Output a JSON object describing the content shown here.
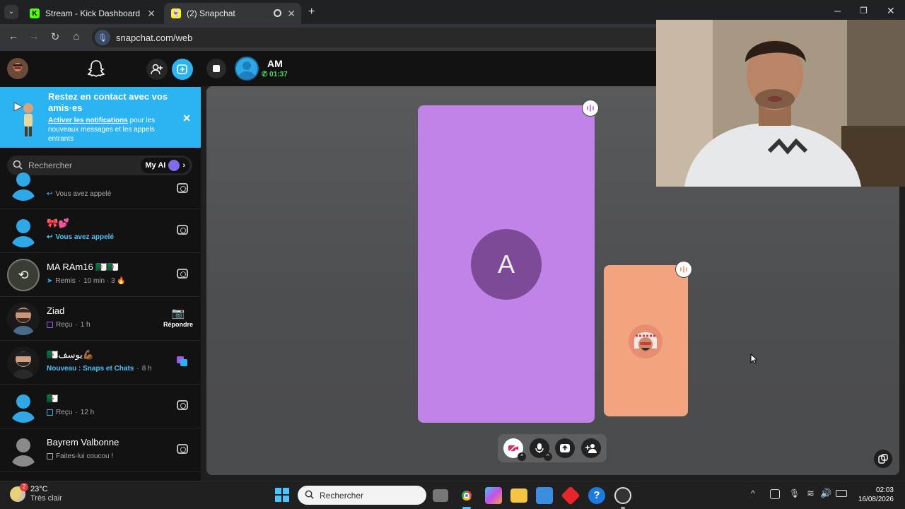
{
  "browser": {
    "tabs": [
      {
        "label": "Stream - Kick Dashboard",
        "favicon": "K"
      },
      {
        "label": "(2) Snapchat"
      }
    ],
    "url": "snapchat.com/web"
  },
  "notification_banner": {
    "title": "Restez en contact avec vos amis·es",
    "link": "Activer les notifications",
    "body": " pour les nouveaux messages et les appels entrants"
  },
  "search": {
    "placeholder": "Rechercher",
    "myai_label": "My AI"
  },
  "chats": [
    {
      "name": "",
      "status": "Vous avez appelé",
      "status_color": "#a8a8a8",
      "avatar": "blue"
    },
    {
      "name": "🎀💕",
      "status": "Vous avez appelé",
      "status_color": "#4fc3f7",
      "avatar": "blue"
    },
    {
      "name": "MA RAm16 🇩🇿🇩🇿",
      "status": "Remis",
      "meta": "10 min · 3 🔥",
      "avatar": "photo"
    },
    {
      "name": "Ziad",
      "status": "Reçu",
      "meta": "1 h",
      "action": "Répondre",
      "avatar": "bitmoji"
    },
    {
      "name": "🇩🇿يوسف💪🏾",
      "status": "Nouveau : Snaps et Chats",
      "meta": "8 h",
      "status_color": "#4fc3f7",
      "avatar": "bitmoji2"
    },
    {
      "name": "🇩🇿",
      "status": "Reçu",
      "meta": "12 h",
      "avatar": "blue"
    },
    {
      "name": "Bayrem Valbonne",
      "status": "Faites-lui coucou !",
      "avatar": "grey"
    }
  ],
  "call": {
    "contact": "AM",
    "timer": "01:37",
    "tile_a_initial": "A"
  },
  "taskbar": {
    "weather_temp": "23°C",
    "weather_desc": "Très clair",
    "weather_badge": "2",
    "search_placeholder": "Rechercher",
    "time": "02:03",
    "date": "16/08/2026"
  },
  "colors": {
    "snap_blue": "#2cb4f2",
    "tile_a": "#c283e8",
    "tile_b": "#f2a47f",
    "timer_green": "#4cd964"
  }
}
